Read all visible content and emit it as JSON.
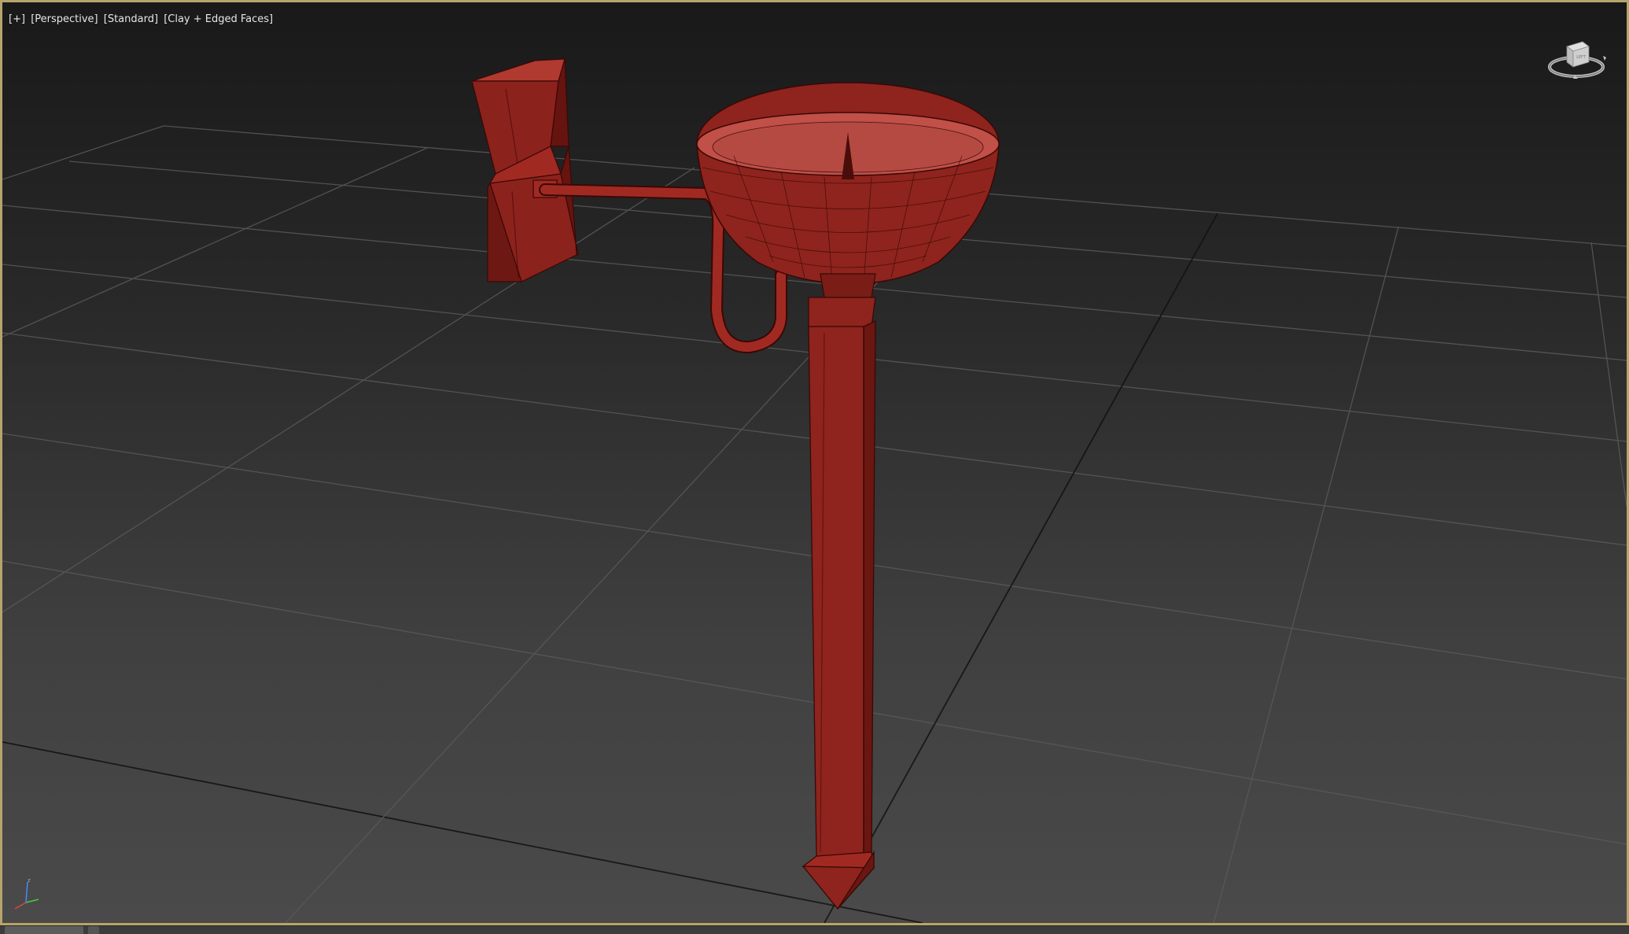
{
  "viewport": {
    "label_parts": [
      "[+]",
      "[Perspective]",
      "[Standard]",
      "[Clay + Edged Faces]"
    ],
    "viewcube_face": "LEFT",
    "active_border_color": "#b7a46a",
    "background_top": "#191919",
    "background_bottom": "#4a4a4a"
  },
  "scene": {
    "model_color": "#9e2a22",
    "model_edge_color": "#3a0806",
    "grid_color": "#5a5a5a",
    "objects": [
      "wall-mount-bracket",
      "connecting-pipe",
      "bowl",
      "pole",
      "pole-spike"
    ]
  },
  "icons": {
    "viewcube": "viewcube-icon",
    "axis": "axis-tripod-icon"
  }
}
